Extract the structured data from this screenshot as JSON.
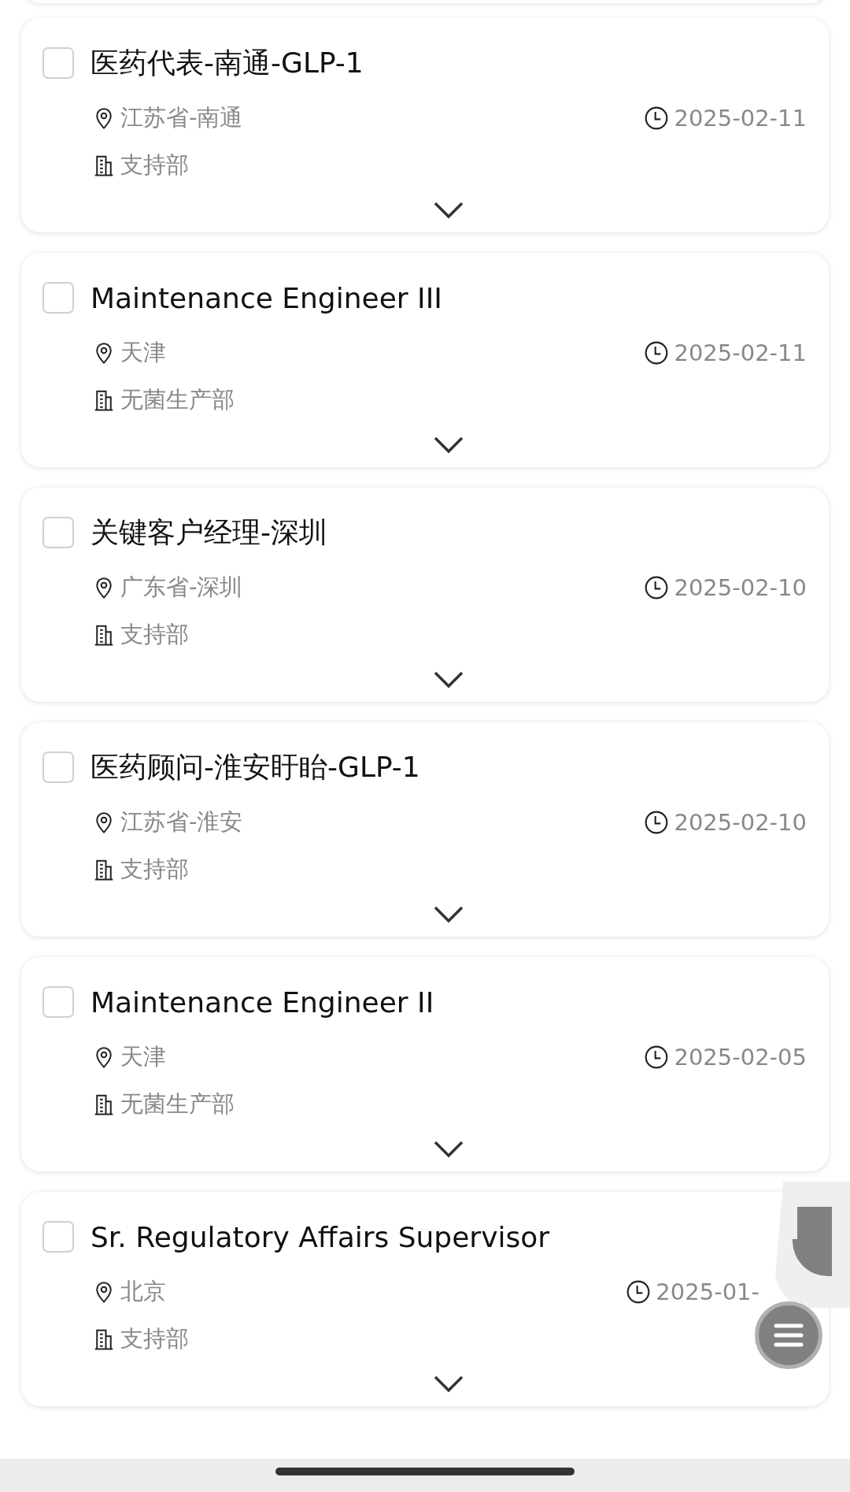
{
  "jobs": [
    {
      "title": "医药代表-南通-GLP-1",
      "location": "江苏省-南通",
      "date": "2025-02-11",
      "department": "支持部",
      "checked": false
    },
    {
      "title": "Maintenance Engineer III",
      "location": "天津",
      "date": "2025-02-11",
      "department": "无菌生产部",
      "checked": false
    },
    {
      "title": "关键客户经理-深圳",
      "location": "广东省-深圳",
      "date": "2025-02-10",
      "department": "支持部",
      "checked": false
    },
    {
      "title": "医药顾问-淮安盱眙-GLP-1",
      "location": "江苏省-淮安",
      "date": "2025-02-10",
      "department": "支持部",
      "checked": false
    },
    {
      "title": "Maintenance Engineer II",
      "location": "天津",
      "date": "2025-02-05",
      "department": "无菌生产部",
      "checked": false
    },
    {
      "title": "Sr. Regulatory Affairs Supervisor",
      "location": "北京",
      "date": "2025-01-",
      "department": "支持部",
      "checked": false
    }
  ]
}
